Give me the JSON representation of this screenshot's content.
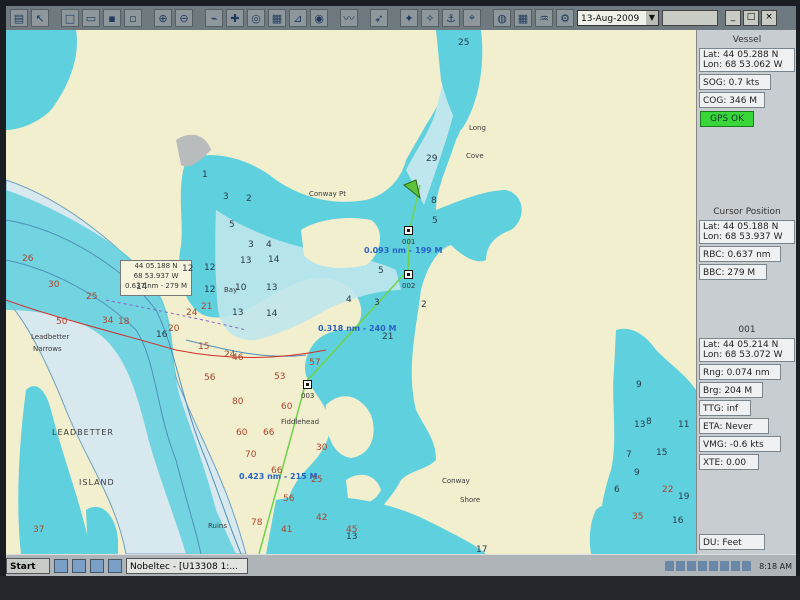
{
  "toolbar": {
    "date": "13-Aug-2009"
  },
  "chart": {
    "place_labels": [
      {
        "id": "long",
        "text": "Long"
      },
      {
        "id": "cove",
        "text": "Cove"
      },
      {
        "id": "conway-pt",
        "text": "Conway Pt"
      },
      {
        "id": "leadbetter-narrows-1",
        "text": "Leadbetter"
      },
      {
        "id": "leadbetter-narrows-2",
        "text": "Narrows"
      },
      {
        "id": "leadbetter",
        "text": "LEADBETTER"
      },
      {
        "id": "island",
        "text": "ISLAND"
      },
      {
        "id": "fiddlehead",
        "text": "Fiddlehead"
      },
      {
        "id": "conway-shore-1",
        "text": "Conway"
      },
      {
        "id": "conway-shore-2",
        "text": "Shore"
      },
      {
        "id": "ruins",
        "text": "Ruins"
      },
      {
        "id": "bay",
        "text": "Bay"
      }
    ],
    "cursor_tooltip": {
      "line1": "44 05.188 N",
      "line2": "68 53.937 W",
      "line3": "0.637 nm - 279 M"
    },
    "measurements": [
      {
        "id": "leg1",
        "text": "0.093 nm - 199 M"
      },
      {
        "id": "leg2",
        "text": "0.318 nm - 240 M"
      },
      {
        "id": "leg3",
        "text": "0.423 nm - 215 M"
      }
    ],
    "waypoints": [
      {
        "id": "001",
        "label": "001"
      },
      {
        "id": "002",
        "label": "002"
      },
      {
        "id": "003",
        "label": "003"
      }
    ],
    "depths_red": [
      "26",
      "30",
      "25",
      "21",
      "20",
      "18",
      "15",
      "24",
      "34",
      "50",
      "46",
      "56",
      "53",
      "57",
      "60",
      "66",
      "80",
      "70",
      "66",
      "60",
      "56",
      "78",
      "41",
      "42",
      "45",
      "37",
      "35",
      "22",
      "24",
      "25",
      "30"
    ],
    "depths_blue": [
      "1",
      "3",
      "2",
      "5",
      "4",
      "3",
      "12",
      "13",
      "14",
      "12",
      "10",
      "13",
      "5",
      "4",
      "3",
      "2",
      "9",
      "8",
      "11",
      "15",
      "6",
      "7",
      "9",
      "16",
      "19",
      "17",
      "13",
      "14",
      "8",
      "5",
      "25",
      "29",
      "21",
      "16",
      "13",
      "12",
      "14",
      "13"
    ]
  },
  "panel": {
    "vessel": {
      "title": "Vessel",
      "lat": "Lat: 44 05.288 N",
      "lon": "Lon: 68 53.062 W",
      "sog": "SOG: 0.7 kts",
      "cog": "COG: 346 M",
      "gps": "GPS OK"
    },
    "cursor": {
      "title": "Cursor Position",
      "lat": "Lat:  44 05.188 N",
      "lon": "Lon:  68 53.937 W",
      "rbc": "RBC: 0.637 nm",
      "bbc": "BBC: 279 M"
    },
    "waypoint": {
      "title": "001",
      "lat": "Lat:  44 05.214 N",
      "lon": "Lon:  68 53.072 W",
      "rng": "Rng: 0.074 nm",
      "brg": "Brg: 204 M",
      "ttg": "TTG: inf",
      "eta": "ETA: Never",
      "vmg": "VMG: -0.6 kts",
      "xte": "XTE: 0.00",
      "du": "DU: Feet"
    }
  },
  "taskbar": {
    "start": "Start",
    "task": "Nobeltec - [U13308 1:...",
    "clock": "8:18 AM"
  }
}
